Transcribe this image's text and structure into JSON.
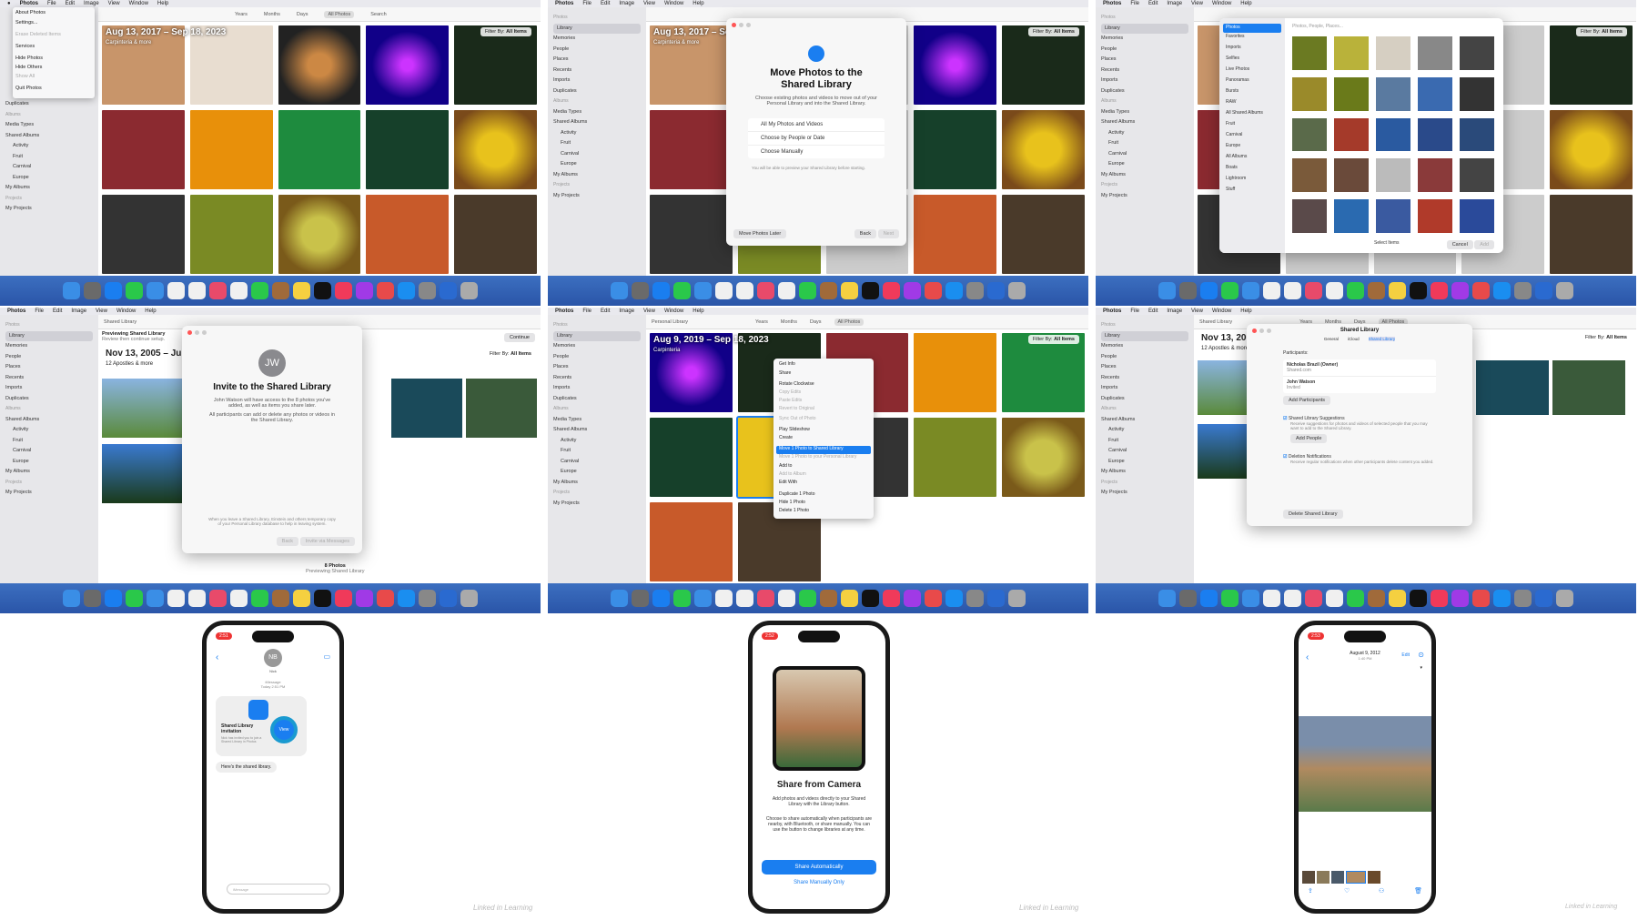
{
  "menubar": {
    "apple": "",
    "app": "Photos",
    "items": [
      "File",
      "Edit",
      "Image",
      "View",
      "Window",
      "Help"
    ]
  },
  "toolbar": {
    "tabs": [
      "Years",
      "Months",
      "Days",
      "All Photos"
    ],
    "search": "Search"
  },
  "sidebar": {
    "header_photos": "Photos",
    "library": "Library",
    "memories": "Memories",
    "people": "People",
    "places": "Places",
    "recents": "Recents",
    "imports": "Imports",
    "duplicates": "Duplicates",
    "header_albums": "Albums",
    "media_types": "Media Types",
    "shared_albums": "Shared Albums",
    "activity": "Activity",
    "fruit": "Fruit",
    "carnival": "Carnival",
    "europe": "Europe",
    "my_albums": "My Albums",
    "header_projects": "Projects",
    "my_projects": "My Projects"
  },
  "filter": {
    "label": "Filter By:",
    "value": "All Items"
  },
  "p1": {
    "date": "Aug 13, 2017 – Sep 18, 2023",
    "sub": "Carpinteria & more",
    "menu": [
      "About Photos",
      "Settings...",
      "Erase Deleted Items",
      "Services",
      "Hide Photos",
      "Hide Others",
      "Show All",
      "Quit Photos"
    ]
  },
  "p2": {
    "date": "Aug 13, 2017 – Sep 1",
    "sub": "Carpinteria & more",
    "title": "Move Photos to the Shared Library",
    "desc": "Choose existing photos and videos to move out of your Personal Library and into the Shared Library.",
    "opts": [
      "All My Photos and Videos",
      "Choose by People or Date",
      "Choose Manually"
    ],
    "note": "You will be able to preview your Shared Library before starting.",
    "later": "Move Photos Later",
    "back": "Back",
    "next": "Next"
  },
  "p3": {
    "search": "Photos, People, Places...",
    "side": [
      "Photos",
      "Favorites",
      "Imports",
      "Selfies",
      "Live Photos",
      "Panoramas",
      "Bursts",
      "RAW",
      "All Shared Albums",
      "Fruit",
      "Carnival",
      "Europe",
      "All Albums",
      "Boats",
      "Lightroom",
      "Stuff"
    ],
    "select": "Select Items",
    "cancel": "Cancel",
    "add": "Add"
  },
  "p4": {
    "toolbar": "Shared Library",
    "preview": "Previewing Shared Library",
    "review": "Review then continue setup.",
    "continue": "Continue",
    "date": "Nov 13, 2005 – Jun 1",
    "sub": "12 Apostles & more",
    "initials": "JW",
    "title": "Invite to the Shared Library",
    "desc": "John Watson will have access to the 8 photos you've added, as well as items you share later.",
    "desc2": "All participants can add or delete any photos or videos in the Shared Library.",
    "note": "When you leave a Shared Library, Einstein and others temporary copy of your Personal Library database to help in leaving system.",
    "back": "Back",
    "invite": "Invite via Messages",
    "count": "8 Photos",
    "counttag": "Previewing Shared Library"
  },
  "p5": {
    "toolbar": "Personal Library",
    "date": "Aug 9, 2019 – Sep 18, 2023",
    "sub": "Carpinteria",
    "menu": [
      "Get Info",
      "Share",
      "Rotate Clockwise",
      "Copy Edits",
      "Paste Edits",
      "Revert to Original",
      "Sync Out of Photo",
      "Play Slideshow",
      "Create",
      "Move 1 Photo to Shared Library",
      "Move 1 Photo to your Personal Library",
      "Add to",
      "Add to Album",
      "Edit With",
      "Duplicate 1 Photo",
      "Hide 1 Photo",
      "Delete 1 Photo"
    ],
    "hilite": "Move 1 Photo to Shared Library"
  },
  "p6": {
    "toolbar": "Shared Library",
    "date": "Nov 13, 2005 – Sep 18, 2019",
    "sub": "12 Apostles & more",
    "title": "Shared Library",
    "tabs": [
      "General",
      "iCloud",
      "Shared Library"
    ],
    "participants": "Participants:",
    "p1": "Nicholas Brazil (Owner)",
    "p1sub": "Shared.com",
    "p2": "John Watson",
    "p2sub": "Invited",
    "add_part": "Add Participants",
    "sugg": "Shared Library Suggestions",
    "sugg_desc": "Receive suggestions for photos and videos of selected people that you may want to add to the Shared Library.",
    "add_people": "Add People",
    "del": "Deletion Notifications",
    "del_desc": "Receive regular notifications when other participants delete content you added.",
    "delete_btn": "Delete Shared Library"
  },
  "ph1": {
    "time": "2:51",
    "initials": "NB",
    "name": "Nick",
    "sub": "iMessage",
    "sub2": "Today 2:51 PM",
    "title": "Shared Library invitation",
    "desc": "Nick has invited you to join a Shared Library in Photos",
    "view": "View",
    "msg": "Here's the shared library.",
    "input": "iMessage"
  },
  "ph2": {
    "time": "2:52",
    "title": "Share from Camera",
    "desc": "Add photos and videos directly to your Shared Library with the Library button.",
    "desc2": "Choose to share automatically when participants are nearby, with Bluetooth, or share manually. You can use the button to change libraries at any time.",
    "auto": "Share Automatically",
    "manual": "Share Manually Only"
  },
  "ph3": {
    "time": "2:53",
    "date": "August 9, 2012",
    "sub": "1:40 PM",
    "edit": "Edit"
  },
  "watermark": "Linked in Learning"
}
